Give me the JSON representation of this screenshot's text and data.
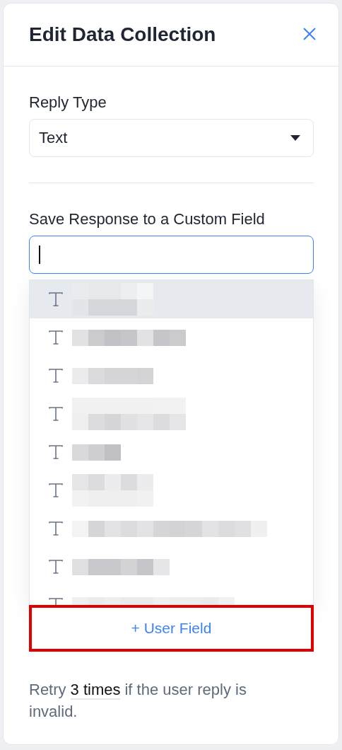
{
  "dialog": {
    "title": "Edit Data Collection"
  },
  "reply_type": {
    "label": "Reply Type",
    "value": "Text"
  },
  "custom_field": {
    "label": "Save Response to a Custom Field",
    "focused": true
  },
  "field_options": [
    {
      "kind": "text",
      "highlighted": true
    },
    {
      "kind": "text",
      "highlighted": false
    },
    {
      "kind": "text",
      "highlighted": false
    },
    {
      "kind": "text",
      "highlighted": false
    },
    {
      "kind": "text",
      "highlighted": false
    },
    {
      "kind": "text",
      "highlighted": false
    },
    {
      "kind": "text",
      "highlighted": false
    },
    {
      "kind": "text",
      "highlighted": false
    },
    {
      "kind": "text",
      "highlighted": false
    }
  ],
  "add_button": {
    "label": "+ User Field",
    "outlined": true
  },
  "retry": {
    "before": "Retry",
    "count": "3 times",
    "after": "if the user reply is invalid."
  }
}
